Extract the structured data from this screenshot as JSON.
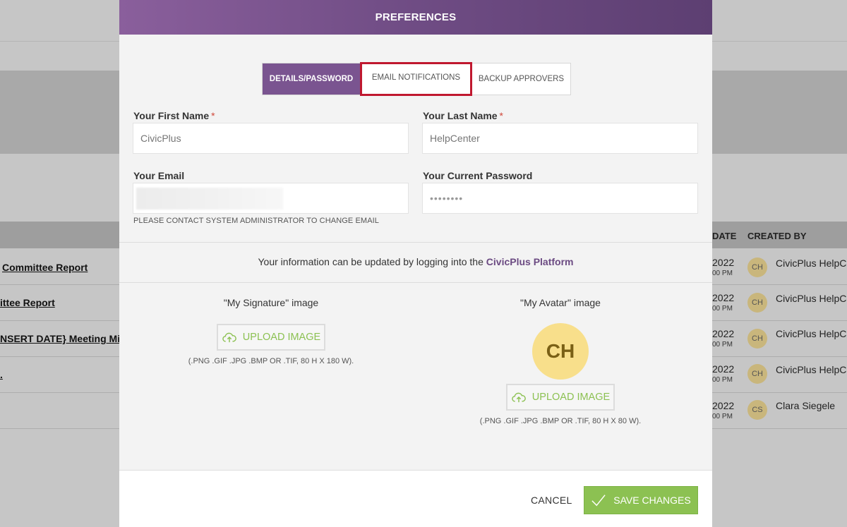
{
  "background": {
    "headers": {
      "date": "DATE",
      "created_by": "CREATED BY"
    },
    "rows": [
      {
        "title": "Committee Report",
        "date": "2022",
        "time": "00 PM",
        "initials": "CH",
        "creator": "CivicPlus HelpCe"
      },
      {
        "title": "ittee Report",
        "date": "2022",
        "time": "00 PM",
        "initials": "CH",
        "creator": "CivicPlus HelpCe"
      },
      {
        "title": "NSERT DATE} Meeting Minu",
        "date": "2022",
        "time": "00 PM",
        "initials": "CH",
        "creator": "CivicPlus HelpCe"
      },
      {
        "title": "",
        "date": "2022",
        "time": "00 PM",
        "initials": "CH",
        "creator": "CivicPlus HelpCe"
      },
      {
        "title": "",
        "date": "2022",
        "time": "00 PM",
        "initials": "CS",
        "creator": "Clara Siegele"
      }
    ]
  },
  "modal": {
    "title": "PREFERENCES",
    "tabs": [
      "DETAILS/PASSWORD",
      "EMAIL NOTIFICATIONS",
      "BACKUP APPROVERS"
    ],
    "first_name": {
      "label": "Your First Name",
      "required": "*",
      "placeholder": "CivicPlus"
    },
    "last_name": {
      "label": "Your Last Name",
      "required": "*",
      "placeholder": "HelpCenter"
    },
    "email": {
      "label": "Your Email",
      "hint": "PLEASE CONTACT SYSTEM ADMINISTRATOR TO CHANGE EMAIL"
    },
    "password": {
      "label": "Your Current Password",
      "value": "••••••••"
    },
    "info_text": "Your information can be updated by logging into the ",
    "info_link": "CivicPlus Platform",
    "signature": {
      "label": "\"My Signature\" image",
      "button": "UPLOAD IMAGE",
      "note": "(.PNG .GIF .JPG .BMP OR .TIF, 80 H X 180 W)."
    },
    "avatar": {
      "label": "\"My Avatar\" image",
      "initials": "CH",
      "button": "UPLOAD IMAGE",
      "note": "(.PNG .GIF .JPG .BMP OR .TIF, 80 H X 80 W)."
    },
    "footer": {
      "cancel": "CANCEL",
      "save": "SAVE CHANGES"
    }
  },
  "colors": {
    "header_purple": "#7a5490",
    "accent_green": "#8cc152",
    "highlight_red": "#c0182f",
    "avatar_yellow": "#f8df8b"
  }
}
